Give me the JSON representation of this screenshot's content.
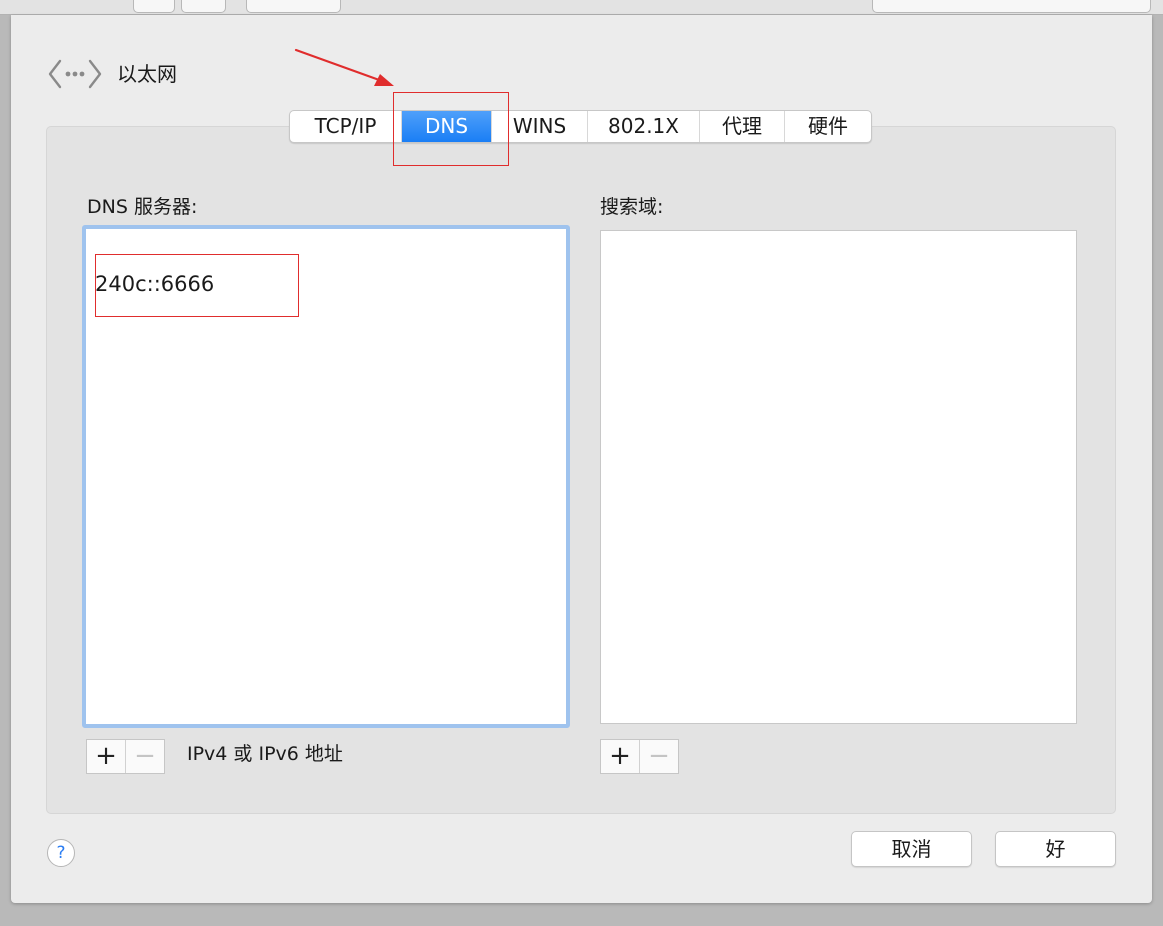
{
  "window": {
    "service_name": "以太网"
  },
  "tabs": [
    {
      "label": "TCP/IP",
      "active": false
    },
    {
      "label": "DNS",
      "active": true
    },
    {
      "label": "WINS",
      "active": false
    },
    {
      "label": "802.1X",
      "active": false
    },
    {
      "label": "代理",
      "active": false
    },
    {
      "label": "硬件",
      "active": false
    }
  ],
  "dns_servers": {
    "label": "DNS 服务器:",
    "entries": [
      "240c::6666"
    ],
    "add_symbol": "+",
    "remove_symbol": "−",
    "hint": "IPv4 或 IPv6 地址"
  },
  "search_domains": {
    "label": "搜索域:",
    "entries": [],
    "add_symbol": "+",
    "remove_symbol": "−"
  },
  "footer": {
    "help_symbol": "?",
    "cancel_label": "取消",
    "ok_label": "好"
  },
  "colors": {
    "accent": "#1a7ef5",
    "focus_ring": "#9fc3ee",
    "annotation": "#e02d2d"
  },
  "icons": {
    "back": "network-back-icon",
    "annotation_arrow": "arrow-annotation"
  }
}
